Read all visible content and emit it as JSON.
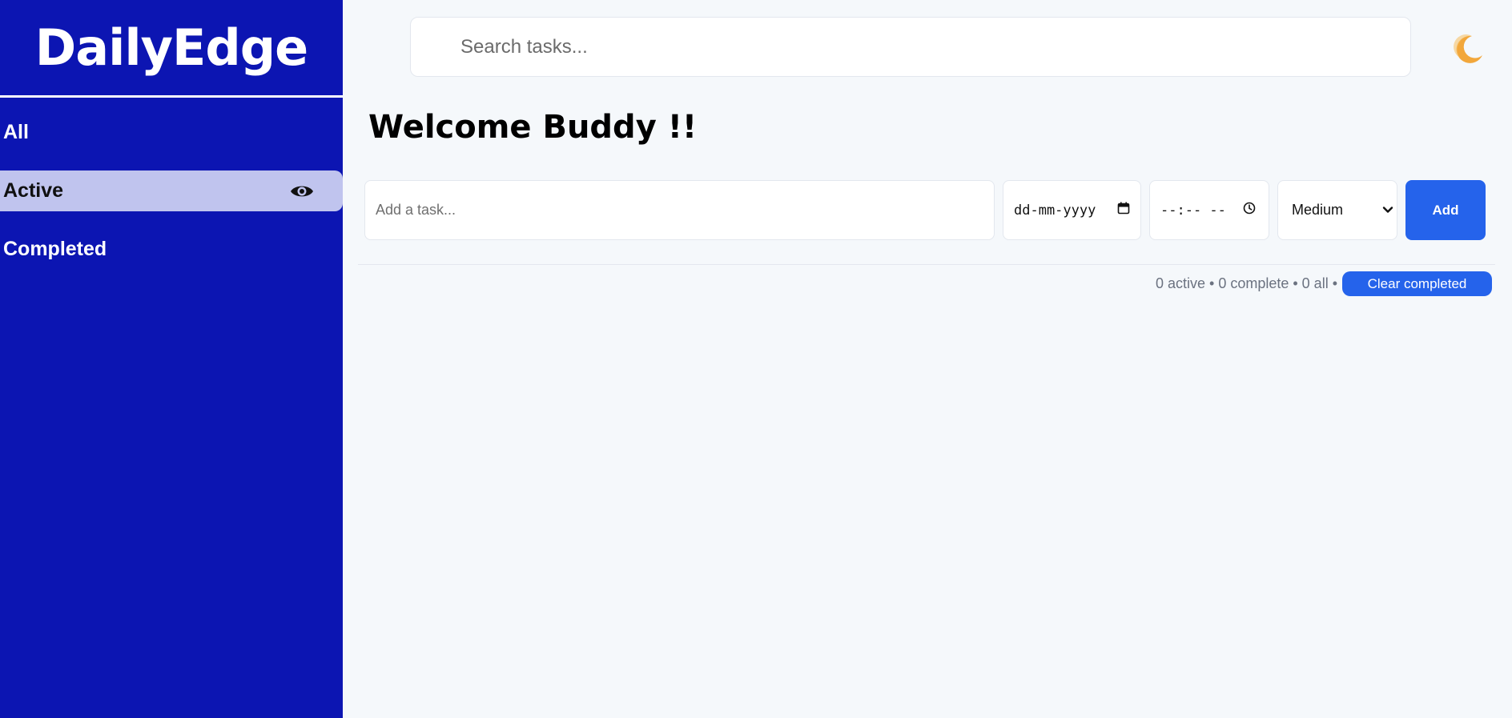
{
  "sidebar": {
    "brand": "DailyEdge",
    "items": [
      {
        "label": "All",
        "selected": false
      },
      {
        "label": "Active",
        "selected": true,
        "icon": "eye-icon"
      },
      {
        "label": "Completed",
        "selected": false
      }
    ]
  },
  "header": {
    "search_placeholder": "Search tasks...",
    "theme_icon": "moon-icon"
  },
  "main": {
    "welcome": "Welcome Buddy !!",
    "form": {
      "task_placeholder": "Add a task...",
      "date_placeholder": "dd-mm-yyyy",
      "time_placeholder": "--:-- --",
      "priority_selected": "Medium",
      "add_label": "Add"
    },
    "stats": {
      "text": "0 active • 0 complete • 0 all •",
      "clear_label": "Clear completed"
    }
  },
  "colors": {
    "sidebar_bg": "#0c15b2",
    "active_item_bg": "#c0c4ee",
    "accent": "#2563eb",
    "page_bg": "#f5f8fb"
  }
}
